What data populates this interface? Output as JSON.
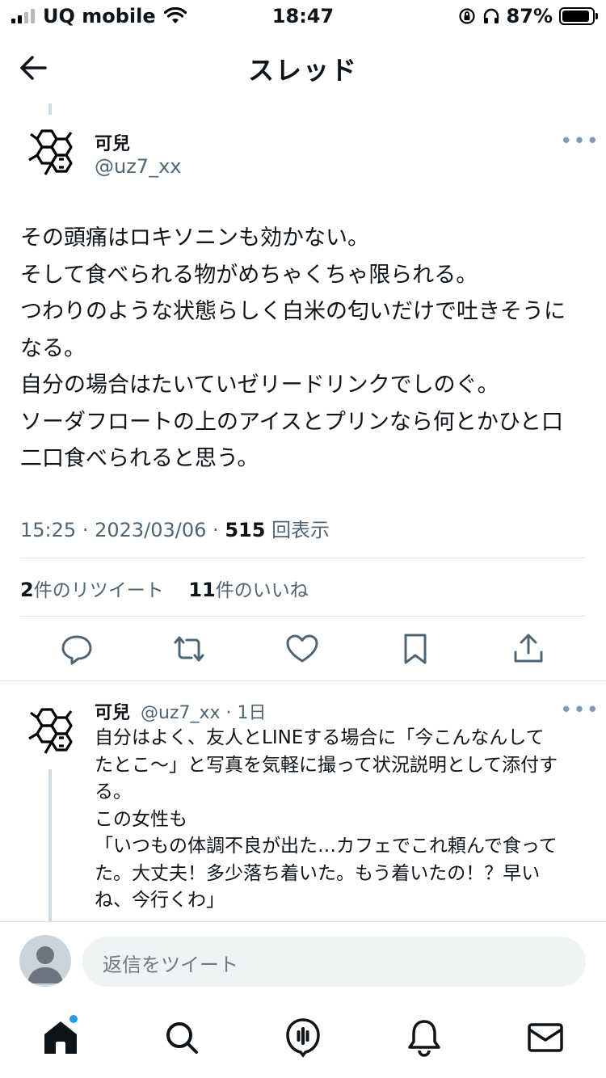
{
  "status_bar": {
    "carrier": "UQ mobile",
    "time": "18:47",
    "battery": "87%"
  },
  "header": {
    "title": "スレッド"
  },
  "main_tweet": {
    "author_name": "可兒",
    "author_handle": "@uz7_xx",
    "more": "•••",
    "lines": [
      "その頭痛はロキソニンも効かない。",
      "そして食べられる物がめちゃくちゃ限られる。",
      "つわりのような状態らしく白米の匂いだけで吐きそうに",
      "なる。",
      "自分の場合はたいていゼリードリンクでしのぐ。",
      "ソーダフロートの上のアイスとプリンなら何とかひと口",
      "二口食べられると思う。"
    ],
    "time": "15:25",
    "date": "2023/03/06",
    "views_count": "515",
    "views_label": "回表示",
    "retweets_count": "2",
    "retweets_label": "件のリツイート",
    "likes_count": "11",
    "likes_label": "件のいいね"
  },
  "actions": [
    "reply-icon",
    "retweet-icon",
    "like-icon",
    "bookmark-icon",
    "share-icon"
  ],
  "reply_tweet": {
    "author_name": "可兒",
    "author_handle": "@uz7_xx",
    "age": "1日",
    "more": "•••",
    "lines": [
      "自分はよく、友人とLINEする場合に「今こんなんして",
      "たとこ〜」と写真を気軽に撮って状況説明として添付す",
      "る。",
      "この女性も",
      "「いつもの体調不良が出た…カフェでこれ頼んで食って",
      "た。大丈夫！多少落ち着いた。もう着いたの！？早い",
      "ね、今行くわ」"
    ]
  },
  "composer": {
    "placeholder": "返信をツイート"
  },
  "tabbar": {
    "items": [
      "home-icon",
      "search-icon",
      "spaces-icon",
      "notifications-icon",
      "messages-icon"
    ],
    "notification_dot_color": "#1d9bf0"
  }
}
